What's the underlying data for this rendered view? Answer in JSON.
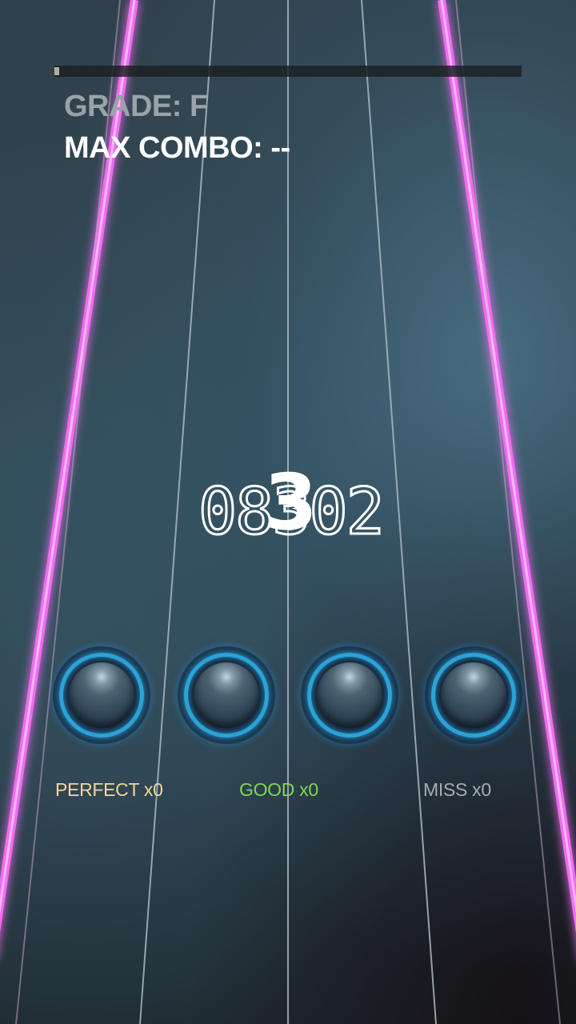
{
  "hud": {
    "progress": 0.01,
    "grade": "GRADE: F",
    "max_combo": "MAX COMBO: --",
    "score": "08302",
    "countdown": "3"
  },
  "judgements": {
    "perfect": "PERFECT x0",
    "good": "GOOD x0",
    "miss": "MISS x0"
  },
  "colors": {
    "lane_edge": "#f06cf2",
    "pad_ring": "#2aa3d8",
    "perfect": "#f1d79b",
    "good": "#7ed94f",
    "miss": "#a6adb1"
  }
}
